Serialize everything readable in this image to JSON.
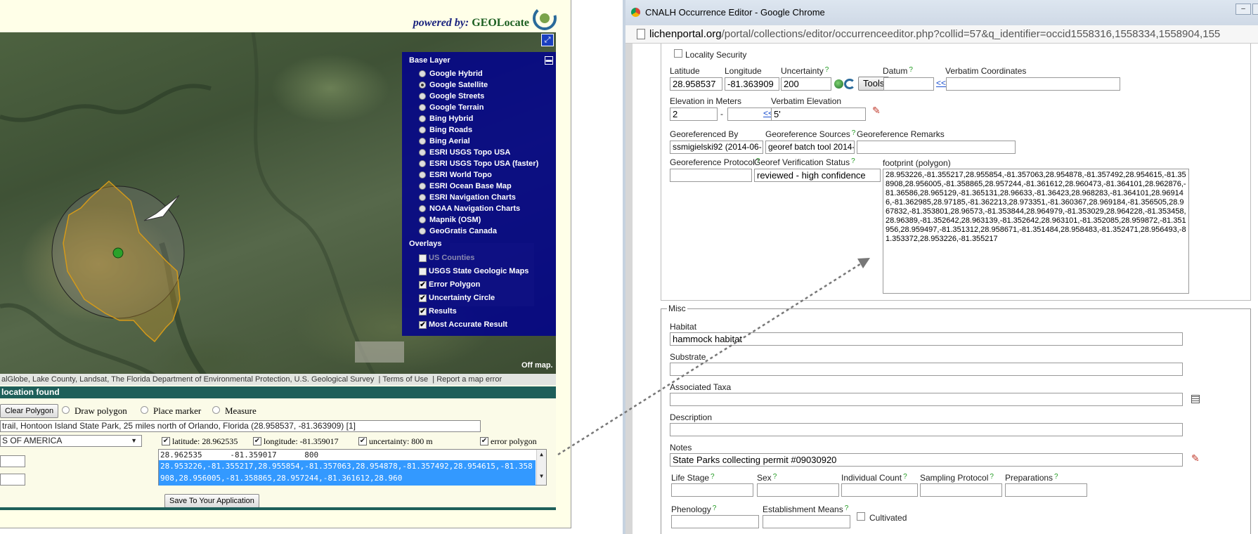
{
  "geolocate": {
    "powered_by_prefix": "powered by:",
    "powered_by_brand": "GEOLocate",
    "base_layer": {
      "title": "Base Layer",
      "items": [
        {
          "label": "Google Hybrid",
          "selected": false
        },
        {
          "label": "Google Satellite",
          "selected": true
        },
        {
          "label": "Google Streets",
          "selected": false
        },
        {
          "label": "Google Terrain",
          "selected": false
        },
        {
          "label": "Bing Hybrid",
          "selected": false
        },
        {
          "label": "Bing Roads",
          "selected": false
        },
        {
          "label": "Bing Aerial",
          "selected": false
        },
        {
          "label": "ESRI USGS Topo USA",
          "selected": false
        },
        {
          "label": "ESRI USGS Topo USA (faster)",
          "selected": false
        },
        {
          "label": "ESRI World Topo",
          "selected": false
        },
        {
          "label": "ESRI Ocean Base Map",
          "selected": false
        },
        {
          "label": "ESRI Navigation Charts",
          "selected": false
        },
        {
          "label": "NOAA Navigation Charts",
          "selected": false
        },
        {
          "label": "Mapnik (OSM)",
          "selected": false
        },
        {
          "label": "GeoGratis Canada",
          "selected": false
        }
      ]
    },
    "overlays": {
      "title": "Overlays",
      "items": [
        {
          "label": "US Counties",
          "checked": false,
          "disabled": true
        },
        {
          "label": "USGS State Geologic Maps",
          "checked": false,
          "disabled": false
        },
        {
          "label": "Error Polygon",
          "checked": true,
          "disabled": false
        },
        {
          "label": "Uncertainty Circle",
          "checked": true,
          "disabled": false
        },
        {
          "label": "Results",
          "checked": true,
          "disabled": false
        },
        {
          "label": "Most Accurate Result",
          "checked": true,
          "disabled": false
        }
      ]
    },
    "off_map": "Off map.",
    "attribution": "alGlobe, Lake County, Landsat, The Florida Department of Environmental Protection, U.S. Geological Survey",
    "terms_link": "Terms of Use",
    "report_link": "Report a map error",
    "status": "location found",
    "clear_polygon": "Clear Polygon",
    "draw_polygon": "Draw polygon",
    "place_marker": "Place marker",
    "measure": "Measure",
    "result_text": "trail, Hontoon Island State Park, 25 miles north of Orlando, Florida (28.958537, -81.363909) [1]",
    "country": "S OF AMERICA",
    "latitude_label": "latitude: 28.962535",
    "longitude_label": "longitude: -81.359017",
    "uncertainty_label": "uncertainty: 800 m",
    "error_polygon_label": "error polygon",
    "coord_line": "28.962535      -81.359017      800",
    "coord_selected": "28.953226,-81.355217,28.955854,-81.357063,28.954878,-81.357492,28.954615,-81.358908,28.956005,-81.358865,28.957244,-81.361612,28.960",
    "save_button": "Save To Your Application"
  },
  "browser": {
    "title": "CNALH Occurrence Editor - Google Chrome",
    "url_domain": "lichenportal.org",
    "url_path": "/portal/collections/editor/occurrenceeditor.php?collid=57&q_identifier=occid1558316,1558334,1558904,155"
  },
  "editor": {
    "locality_security": "Locality Security",
    "latitude_label": "Latitude",
    "latitude": "28.958537",
    "longitude_label": "Longitude",
    "longitude": "-81.363909",
    "uncertainty_label": "Uncertainty",
    "uncertainty": "200",
    "tools_button": "Tools",
    "datum_label": "Datum",
    "datum": "",
    "copy_link": "<<",
    "verbatim_coordinates_label": "Verbatim Coordinates",
    "verbatim_coordinates": "",
    "elevation_label": "Elevation in Meters",
    "elevation_min": "2",
    "elevation_dash": "-",
    "elevation_max": "",
    "verbatim_elevation_label": "Verbatim Elevation",
    "verbatim_elevation": "5'",
    "georeferenced_by_label": "Georeferenced By",
    "georeferenced_by": "ssmigielski92 (2014-06-",
    "georeference_sources_label": "Georeference Sources",
    "georeference_sources": "georef batch tool 2014-",
    "georeference_remarks_label": "Georeference Remarks",
    "georeference_remarks": "",
    "georeference_protocol_label": "Georeference Protocol",
    "georeference_protocol": "",
    "georef_verification_label": "Georef Verification Status",
    "georef_verification": "reviewed - high confidence",
    "footprint_label": "footprint (polygon)",
    "footprint": "28.953226,-81.355217,28.955854,-81.357063,28.954878,-81.357492,28.954615,-81.358908,28.956005,-81.358865,28.957244,-81.361612,28.960473,-81.364101,28.962876,-81.36586,28.965129,-81.365131,28.96633,-81.36423,28.968283,-81.364101,28.969146,-81.362985,28.97185,-81.362213,28.973351,-81.360367,28.969184,-81.356505,28.967832,-81.353801,28.96573,-81.353844,28.964979,-81.353029,28.964228,-81.353458,28.96389,-81.352642,28.963139,-81.352642,28.963101,-81.352085,28.959872,-81.351956,28.959497,-81.351312,28.958671,-81.351484,28.958483,-81.352471,28.956493,-81.353372,28.953226,-81.355217",
    "misc_legend": "Misc",
    "habitat_label": "Habitat",
    "habitat": "hammock habitat",
    "substrate_label": "Substrate",
    "substrate": "",
    "associated_taxa_label": "Associated Taxa",
    "associated_taxa": "",
    "description_label": "Description",
    "description": "",
    "notes_label": "Notes",
    "notes": "State Parks collecting permit #09030920",
    "life_stage_label": "Life Stage",
    "sex_label": "Sex",
    "individual_count_label": "Individual Count",
    "sampling_protocol_label": "Sampling Protocol",
    "preparations_label": "Preparations",
    "phenology_label": "Phenology",
    "establishment_means_label": "Establishment Means",
    "cultivated_label": "Cultivated",
    "help_mark": "?"
  }
}
